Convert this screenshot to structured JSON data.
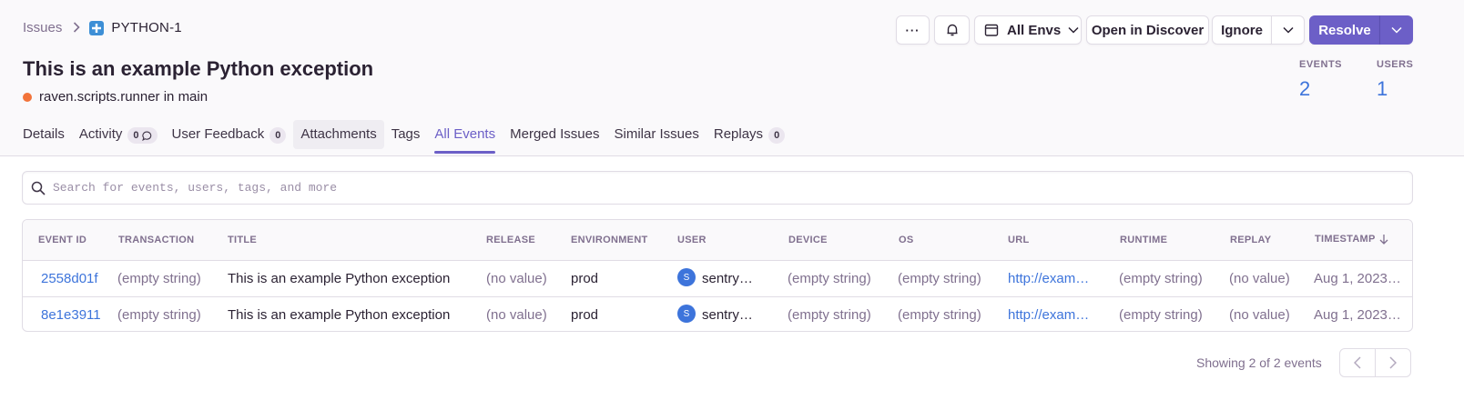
{
  "breadcrumb": {
    "parent": "Issues",
    "current": "PYTHON-1"
  },
  "actions": {
    "more_label": "···",
    "env_label": "All Envs",
    "discover_label": "Open in Discover",
    "ignore_label": "Ignore",
    "resolve_label": "Resolve"
  },
  "issue": {
    "title": "This is an example Python exception",
    "culprit": "raven.scripts.runner in main",
    "level_color": "#f2733a"
  },
  "stats": {
    "events_label": "EVENTS",
    "events_value": "2",
    "users_label": "USERS",
    "users_value": "1"
  },
  "tabs": [
    {
      "label": "Details"
    },
    {
      "label": "Activity",
      "badge": "0"
    },
    {
      "label": "User Feedback",
      "badge": "0"
    },
    {
      "label": "Attachments"
    },
    {
      "label": "Tags"
    },
    {
      "label": "All Events",
      "active": true
    },
    {
      "label": "Merged Issues"
    },
    {
      "label": "Similar Issues"
    },
    {
      "label": "Replays",
      "badge": "0"
    }
  ],
  "search": {
    "placeholder": "Search for events, users, tags, and more"
  },
  "table": {
    "headers": [
      "EVENT ID",
      "TRANSACTION",
      "TITLE",
      "RELEASE",
      "ENVIRONMENT",
      "USER",
      "DEVICE",
      "OS",
      "URL",
      "RUNTIME",
      "REPLAY",
      "TIMESTAMP"
    ],
    "rows": [
      {
        "event_id": "2558d01f",
        "transaction": "(empty string)",
        "title": "This is an example Python exception",
        "release": "(no value)",
        "environment": "prod",
        "user_initial": "S",
        "user": "sentry@…",
        "device": "(empty string)",
        "os": "(empty string)",
        "url": "http://examp…",
        "runtime": "(empty string)",
        "replay": "(no value)",
        "timestamp": "Aug 1, 2023 …"
      },
      {
        "event_id": "8e1e3911",
        "transaction": "(empty string)",
        "title": "This is an example Python exception",
        "release": "(no value)",
        "environment": "prod",
        "user_initial": "S",
        "user": "sentry@…",
        "device": "(empty string)",
        "os": "(empty string)",
        "url": "http://examp…",
        "runtime": "(empty string)",
        "replay": "(no value)",
        "timestamp": "Aug 1, 2023 …"
      }
    ]
  },
  "pagination": {
    "text": "Showing 2 of 2 events"
  },
  "colors": {
    "accent": "#6c5fc7",
    "link": "#3d74db",
    "muted": "#80708f",
    "border": "#e0dce5"
  }
}
